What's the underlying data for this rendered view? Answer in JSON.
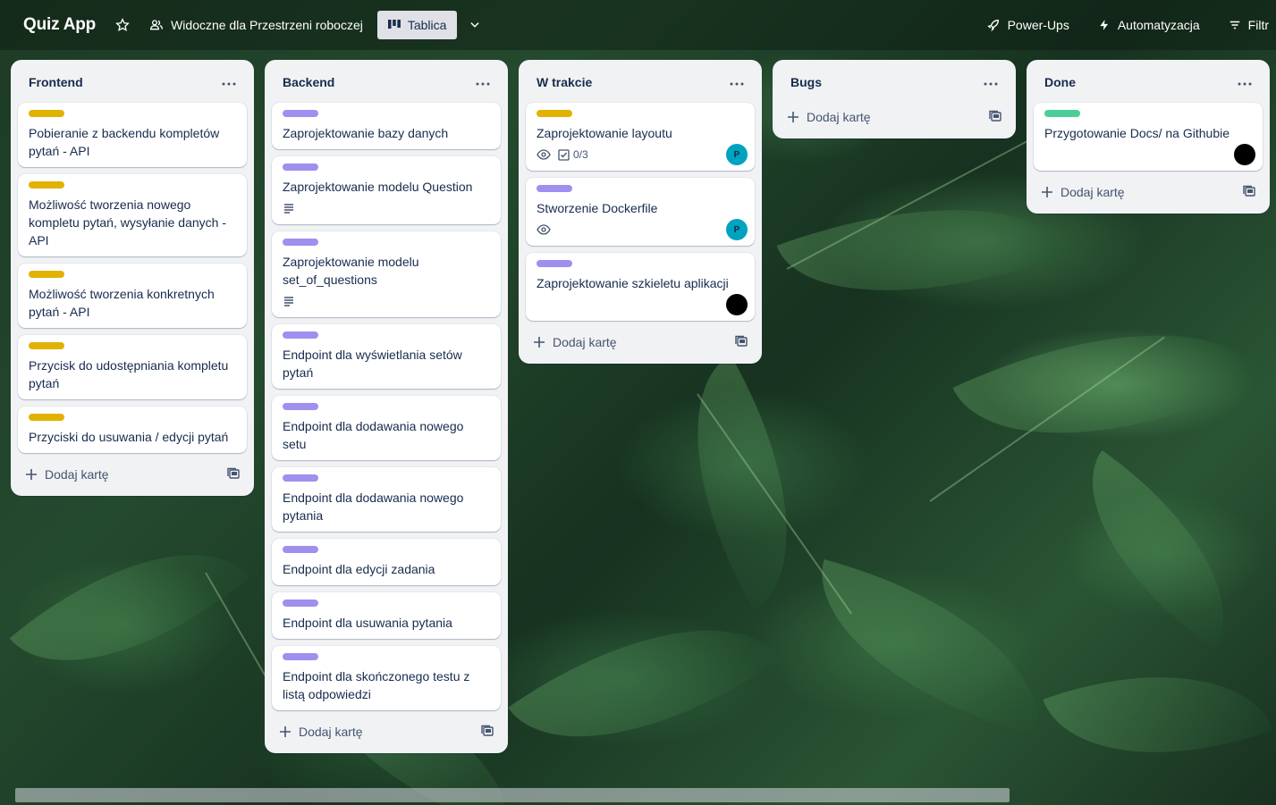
{
  "header": {
    "board_title": "Quiz App",
    "star_icon": "star-icon",
    "visibility_label": "Widoczne dla Przestrzeni roboczej",
    "view_label": "Tablica",
    "power_ups_label": "Power-Ups",
    "automation_label": "Automatyzacja",
    "filter_label": "Filtr"
  },
  "add_card_label": "Dodaj kartę",
  "colors": {
    "label_yellow": "#e2b203",
    "label_purple": "#9f8fef",
    "label_green": "#4bce97",
    "avatar_teal": "#00a3bf",
    "avatar_black": "#000000"
  },
  "lists": [
    {
      "title": "Frontend",
      "cards": [
        {
          "label": "yellow",
          "title": "Pobieranie z backendu kompletów pytań - API"
        },
        {
          "label": "yellow",
          "title": "Możliwość tworzenia nowego kompletu pytań, wysyłanie danych - API"
        },
        {
          "label": "yellow",
          "title": "Możliwość tworzenia konkretnych pytań - API"
        },
        {
          "label": "yellow",
          "title": "Przycisk do udostępniania kompletu pytań"
        },
        {
          "label": "yellow",
          "title": "Przyciski do usuwania / edycji pytań"
        }
      ]
    },
    {
      "title": "Backend",
      "cards": [
        {
          "label": "purple",
          "title": "Zaprojektowanie bazy danych"
        },
        {
          "label": "purple",
          "title": "Zaprojektowanie modelu Question",
          "description": true
        },
        {
          "label": "purple",
          "title": "Zaprojektowanie modelu set_of_questions",
          "description": true
        },
        {
          "label": "purple",
          "title": "Endpoint dla wyświetlania setów pytań"
        },
        {
          "label": "purple",
          "title": "Endpoint dla dodawania nowego setu"
        },
        {
          "label": "purple",
          "title": "Endpoint dla dodawania nowego pytania"
        },
        {
          "label": "purple",
          "title": "Endpoint dla edycji zadania"
        },
        {
          "label": "purple",
          "title": "Endpoint dla usuwania pytania"
        },
        {
          "label": "purple",
          "title": "Endpoint dla skończonego testu z listą odpowiedzi"
        }
      ]
    },
    {
      "title": "W trakcie",
      "cards": [
        {
          "label": "yellow",
          "title": "Zaprojektowanie layoutu",
          "watch": true,
          "checklist": "0/3",
          "avatar": {
            "initial": "P",
            "color": "teal"
          }
        },
        {
          "label": "purple",
          "title": "Stworzenie Dockerfile",
          "watch": true,
          "avatar": {
            "initial": "P",
            "color": "teal"
          }
        },
        {
          "label": "purple",
          "title": "Zaprojektowanie szkieletu aplikacji",
          "avatar": {
            "initial": "",
            "color": "black"
          }
        }
      ]
    },
    {
      "title": "Bugs",
      "cards": []
    },
    {
      "title": "Done",
      "cards": [
        {
          "label": "green",
          "title": "Przygotowanie Docs/ na Githubie",
          "avatar": {
            "initial": "",
            "color": "black"
          }
        }
      ]
    }
  ]
}
